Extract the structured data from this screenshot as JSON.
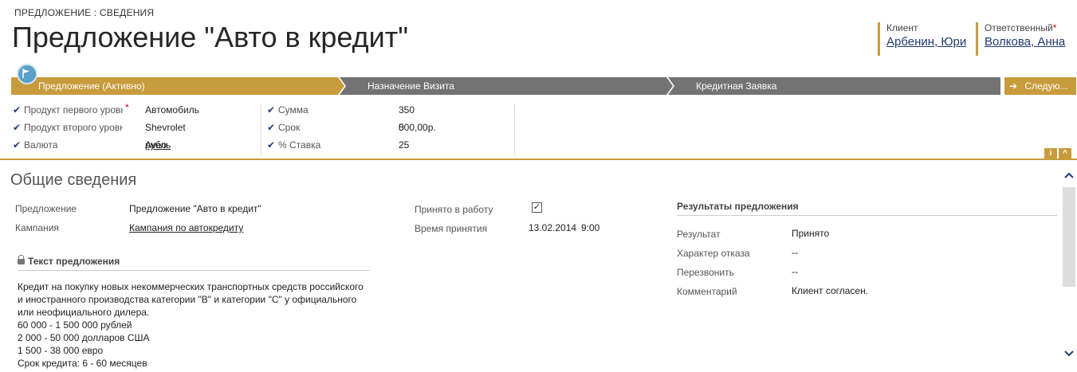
{
  "header": {
    "breadcrumb": "ПРЕДЛОЖЕНИЕ : СВЕДЕНИЯ",
    "title": "Предложение \"Авто в кредит\"",
    "client_label": "Клиент",
    "client_value": "Арбенин, Юрий",
    "owner_label": "Ответственный",
    "owner_required": "*",
    "owner_value": "Волкова, Анна"
  },
  "stages": [
    {
      "label": "Предложение (Активно)"
    },
    {
      "label": "Назначение Визита"
    },
    {
      "label": "Кредитная Заявка"
    }
  ],
  "next_label": "Следую...",
  "process_fields": {
    "col1": [
      {
        "label": "Продукт первого уровня",
        "required": "*",
        "value": "Автомобиль"
      },
      {
        "label": "Продукт второго уровня",
        "value": "Shevrolet Aveo"
      },
      {
        "label": "Валюта",
        "value": "рубль"
      }
    ],
    "col2": [
      {
        "label": "Сумма",
        "value": "350 000,00р."
      },
      {
        "label": "Срок",
        "value": "5"
      },
      {
        "label": "% Ставка",
        "value": "25"
      }
    ]
  },
  "info_btn": "i",
  "collapse_btn": "^",
  "general": {
    "section_title": "Общие сведения",
    "offer_label": "Предложение",
    "offer_value": "Предложение \"Авто в кредит\"",
    "campaign_label": "Кампания",
    "campaign_value": "Кампания по автокредиту",
    "accepted_label": "Принято в работу",
    "accepted_checked": "✓",
    "accepted_time_label": "Время принятия",
    "accepted_date": "13.02.2014",
    "accepted_time": "9:00",
    "text_header": "Текст предложения",
    "text_lines": [
      "Кредит на покупку новых некоммерческих транспортных средств российского",
      "и иностранного производства категории \"В\" и категории \"С\" у официального",
      "или неофициального дилера.",
      "60 000 - 1 500 000 рублей",
      "2 000 - 50 000 долларов США",
      "1 500 - 38 000 евро",
      "Срок кредита: 6 - 60 месяцев"
    ]
  },
  "results": {
    "header": "Результаты предложения",
    "rows": [
      {
        "label": "Результат",
        "value": "Принято"
      },
      {
        "label": "Характер отказа",
        "value": "--"
      },
      {
        "label": "Перезвонить",
        "value": "--"
      },
      {
        "label": "Комментарий",
        "value": "Клиент согласен."
      }
    ]
  },
  "colors": {
    "accent": "#c89b3c",
    "stage_inactive": "#737373",
    "link": "#1f3b73"
  }
}
